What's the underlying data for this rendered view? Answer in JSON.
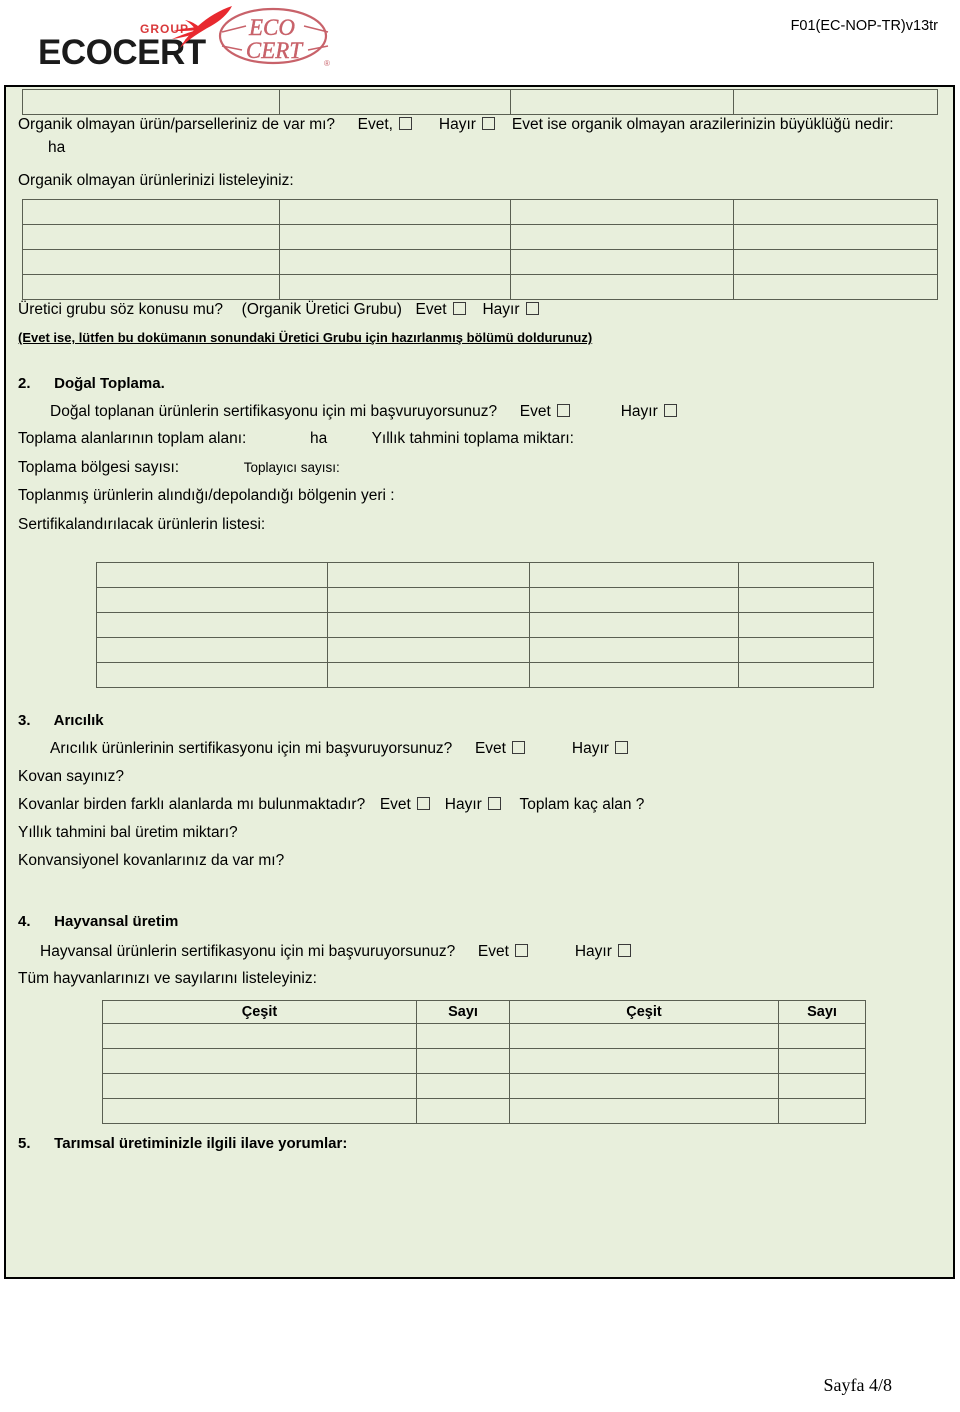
{
  "header": {
    "logo": {
      "group_word": "GROUP",
      "brand_word": "ECOCERT",
      "oval_line1": "ECO",
      "oval_line2": "CERT",
      "registered_mark": "®"
    },
    "doc_code": "F01(EC-NOP-TR)v13tr"
  },
  "organic_section": {
    "q_nonorganic": "Organik olmayan ürün/parselleriniz de var mı?",
    "evet_label": "Evet,",
    "hayir_label": "Hayır",
    "q_nonorganic_tail": "Evet ise organik olmayan arazilerinizin büyüklüğü nedir:",
    "unit_ha": "ha",
    "list_prompt": "Organik olmayan ürünlerinizi listeleyiniz:",
    "table": {
      "columns": 4,
      "rows": [
        [
          "",
          "",
          "",
          ""
        ],
        [
          "",
          "",
          "",
          ""
        ],
        [
          "",
          "",
          "",
          ""
        ],
        [
          "",
          "",
          "",
          ""
        ]
      ]
    }
  },
  "producer_group": {
    "question": "Üretici grubu söz konusu mu?",
    "parenthetical": "(Organik Üretici Grubu)",
    "evet_label": "Evet",
    "hayir_label": "Hayır",
    "note": "(Evet ise, lütfen bu dokümanın sonundaki Üretici Grubu için hazırlanmış bölümü doldurunuz)"
  },
  "section2": {
    "number": "2.",
    "title": "Doğal Toplama.",
    "q_cert": "Doğal toplanan ürünlerin sertifikasyonu için mi başvuruyorsunuz?",
    "evet_label": "Evet",
    "hayir_label": "Hayır",
    "total_area_label": "Toplama alanlarının toplam alanı:",
    "unit_ha": "ha",
    "annual_estimate_label": "Yıllık tahmini toplama miktarı:",
    "region_count_label": "Toplama bölgesi sayısı:",
    "collector_count_label": "Toplayıcı sayısı:",
    "storage_location_label": "Toplanmış ürünlerin alındığı/depolandığı bölgenin yeri :",
    "product_list_label": "Sertifikalandırılacak ürünlerin listesi:",
    "table": {
      "columns": 4,
      "rows": [
        [
          "",
          "",
          "",
          ""
        ],
        [
          "",
          "",
          "",
          ""
        ],
        [
          "",
          "",
          "",
          ""
        ],
        [
          "",
          "",
          "",
          ""
        ],
        [
          "",
          "",
          "",
          ""
        ]
      ]
    }
  },
  "section3": {
    "number": "3.",
    "title": "Arıcılık",
    "q_cert": "Arıcılık ürünlerinin sertifikasyonu için mi başvuruyorsunuz?",
    "evet_label": "Evet",
    "hayir_label": "Hayır",
    "q_hive_count": "Kovan sayınız?",
    "q_multi_area": "Kovanlar birden farklı alanlarda mı bulunmaktadır?",
    "evet_label2": "Evet",
    "hayir_label2": "Hayır",
    "q_total_area": "Toplam kaç alan ?",
    "q_honey_estimate": "Yıllık tahmini bal üretim miktarı?",
    "q_conventional": "Konvansiyonel kovanlarınız da var mı?"
  },
  "section4": {
    "number": "4.",
    "title": "Hayvansal üretim",
    "q_cert": "Hayvansal ürünlerin sertifikasyonu için mi başvuruyorsunuz?",
    "evet_label": "Evet",
    "hayir_label": "Hayır",
    "list_prompt": "Tüm hayvanlarınızı ve sayılarını listeleyiniz:",
    "table": {
      "headers": [
        "Çeşit",
        "Sayı",
        "Çeşit",
        "Sayı"
      ],
      "rows": [
        [
          "",
          "",
          "",
          ""
        ],
        [
          "",
          "",
          "",
          ""
        ],
        [
          "",
          "",
          "",
          ""
        ],
        [
          "",
          "",
          "",
          ""
        ]
      ]
    }
  },
  "section5": {
    "number": "5.",
    "title": "Tarımsal üretiminizle ilgili ilave yorumlar:"
  },
  "footer": {
    "page": "Sayfa 4/8"
  },
  "colors": {
    "panel_bg": "#e8efdc",
    "logo_red": "#d9393b",
    "grid_line": "#5a5f52",
    "text": "#000000"
  }
}
